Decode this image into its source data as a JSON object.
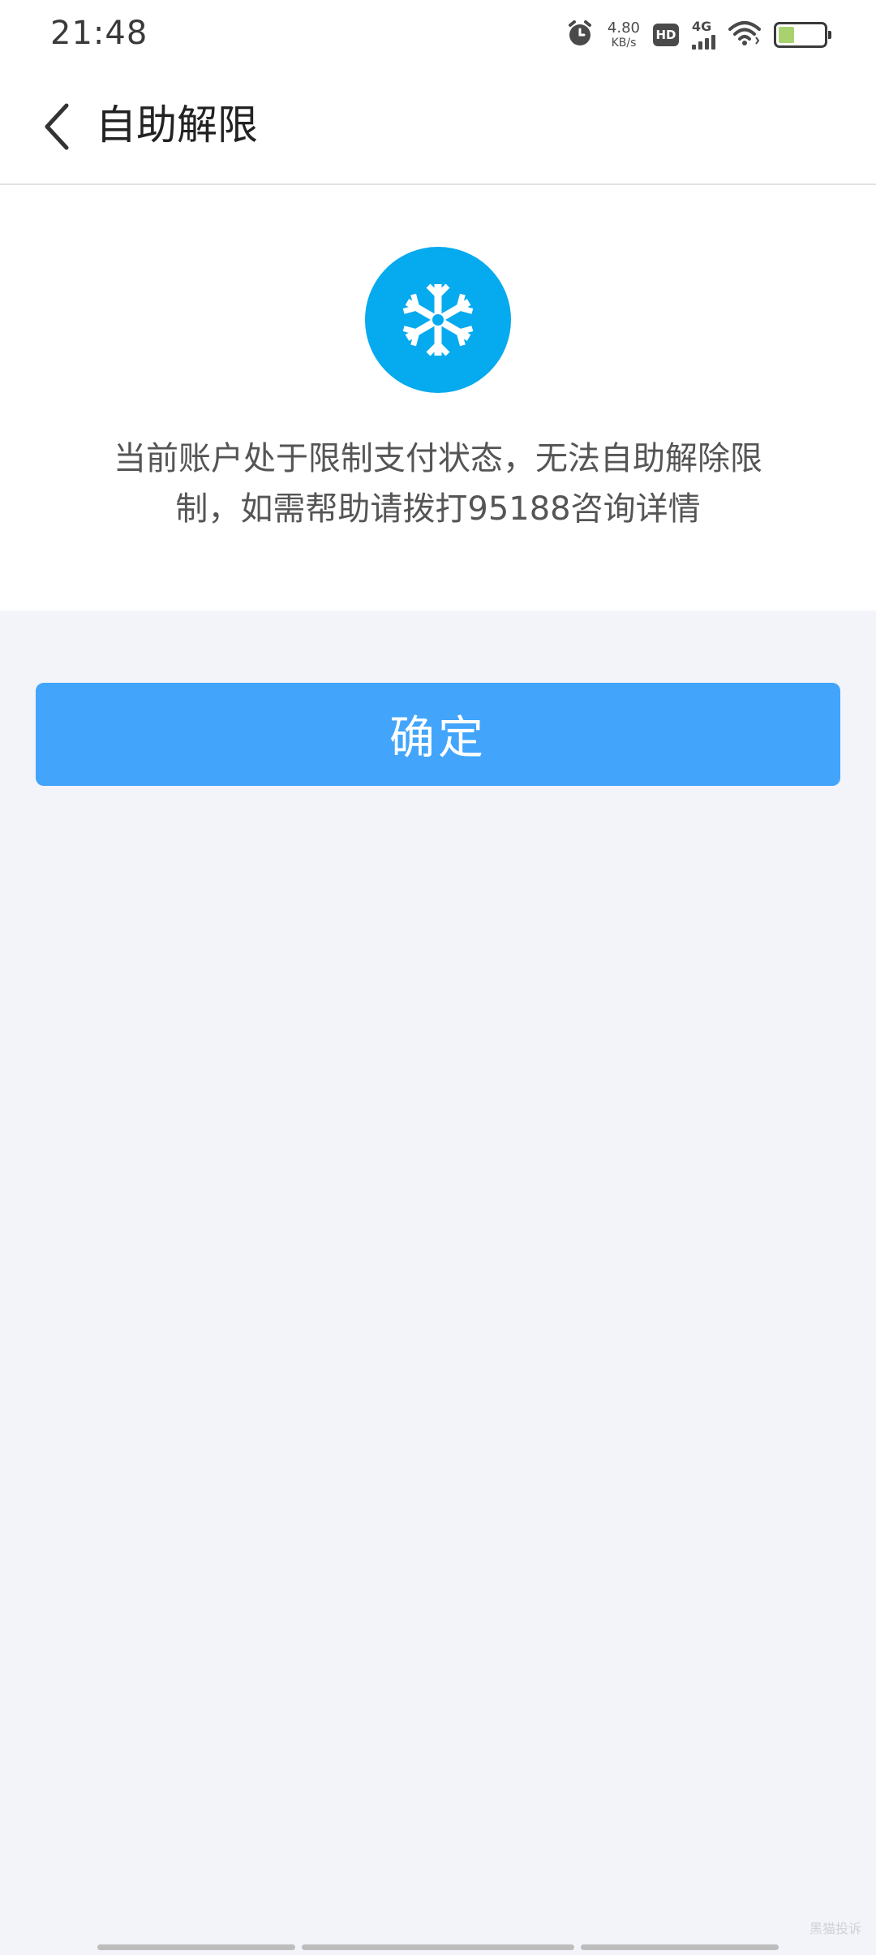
{
  "status_bar": {
    "time": "21:48",
    "net_speed_value": "4.80",
    "net_speed_unit": "KB/s",
    "hd_label": "HD",
    "signal_label": "4G",
    "battery_level": 0.35,
    "battery_fill_color": "#a9d26f",
    "icons": [
      "alarm-icon",
      "hd-icon",
      "signal-icon",
      "wifi-icon",
      "battery-icon"
    ]
  },
  "nav": {
    "back_icon": "chevron-left-icon",
    "title": "自助解限"
  },
  "content": {
    "icon": "snowflake-icon",
    "icon_color": "#06aaee",
    "message_line1": "当前账户处于限制支付状态，无法自助解除限",
    "message_line2": "制，如需帮助请拨打95188咨询详情"
  },
  "actions": {
    "confirm_label": "确定",
    "confirm_color": "#42a5fb"
  },
  "footer": {
    "watermark": "黑猫投诉"
  }
}
